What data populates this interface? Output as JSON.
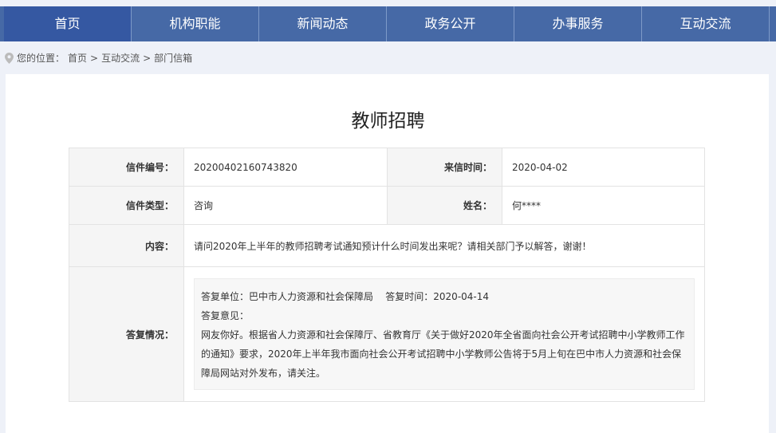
{
  "nav": [
    "首页",
    "机构职能",
    "新闻动态",
    "政务公开",
    "办事服务",
    "互动交流"
  ],
  "breadcrumb": {
    "prefix": "您的位置：",
    "items": [
      "首页",
      "互动交流",
      "部门信箱"
    ],
    "sep": ">"
  },
  "title": "教师招聘",
  "fields": {
    "number_label": "信件编号：",
    "number": "20200402160743820",
    "time_label": "来信时间：",
    "time": "2020-04-02",
    "type_label": "信件类型：",
    "type": "咨询",
    "name_label": "姓名：",
    "name": "何****",
    "content_label": "内容：",
    "content": "请问2020年上半年的教师招聘考试通知预计什么时间发出来呢？请相关部门予以解答，谢谢！",
    "reply_label": "答复情况："
  },
  "reply": {
    "unit": "答复单位：巴中市人力资源和社会保障局",
    "time": "答复时间：2020-04-14",
    "opinion_label": "答复意见：",
    "text": "网友你好。根据省人力资源和社会保障厅、省教育厅《关于做好2020年全省面向社会公开考试招聘中小学教师工作的通知》要求，2020年上半年我市面向社会公开考试招聘中小学教师公告将于5月上旬在巴中市人力资源和社会保障局网站对外发布，请关注。"
  }
}
